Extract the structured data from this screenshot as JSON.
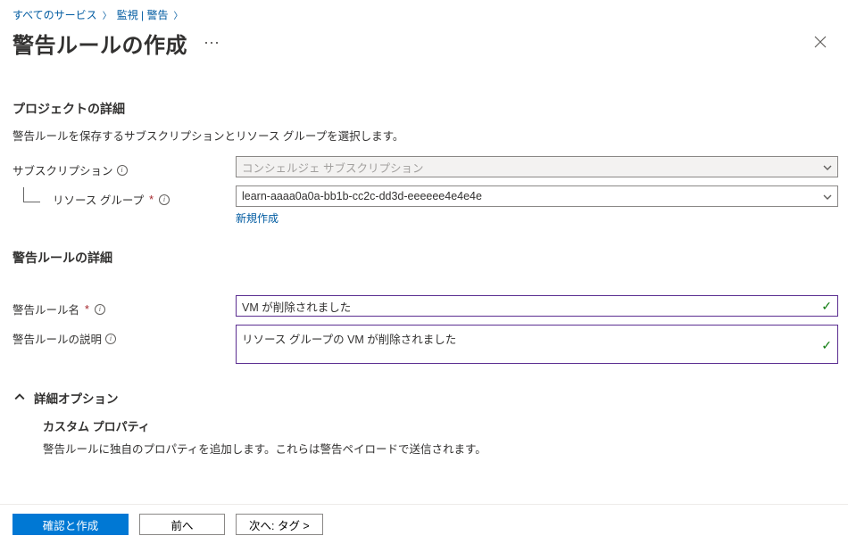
{
  "breadcrumb": {
    "item1": "すべてのサービス",
    "item2": "監視 | 警告"
  },
  "header": {
    "title": "警告ルールの作成"
  },
  "sections": {
    "project": {
      "title": "プロジェクトの詳細",
      "desc": "警告ルールを保存するサブスクリプションとリソース グループを選択します。"
    },
    "rule": {
      "title": "警告ルールの詳細"
    },
    "advanced": {
      "toggle": "詳細オプション",
      "custom_title": "カスタム プロパティ",
      "custom_desc": "警告ルールに独自のプロパティを追加します。これらは警告ペイロードで送信されます。"
    }
  },
  "fields": {
    "subscription": {
      "label": "サブスクリプション",
      "value": "コンシェルジェ サブスクリプション"
    },
    "resource_group": {
      "label": "リソース グループ",
      "value": "learn-aaaa0a0a-bb1b-cc2c-dd3d-eeeeee4e4e4e",
      "create_link": "新規作成"
    },
    "rule_name": {
      "label": "警告ルール名",
      "value": "VM が削除されました"
    },
    "rule_desc": {
      "label": "警告ルールの説明",
      "value": "リソース グループの VM が削除されました"
    }
  },
  "footer": {
    "review": "確認と作成",
    "prev": "前へ",
    "next": "次へ: タグ >"
  }
}
